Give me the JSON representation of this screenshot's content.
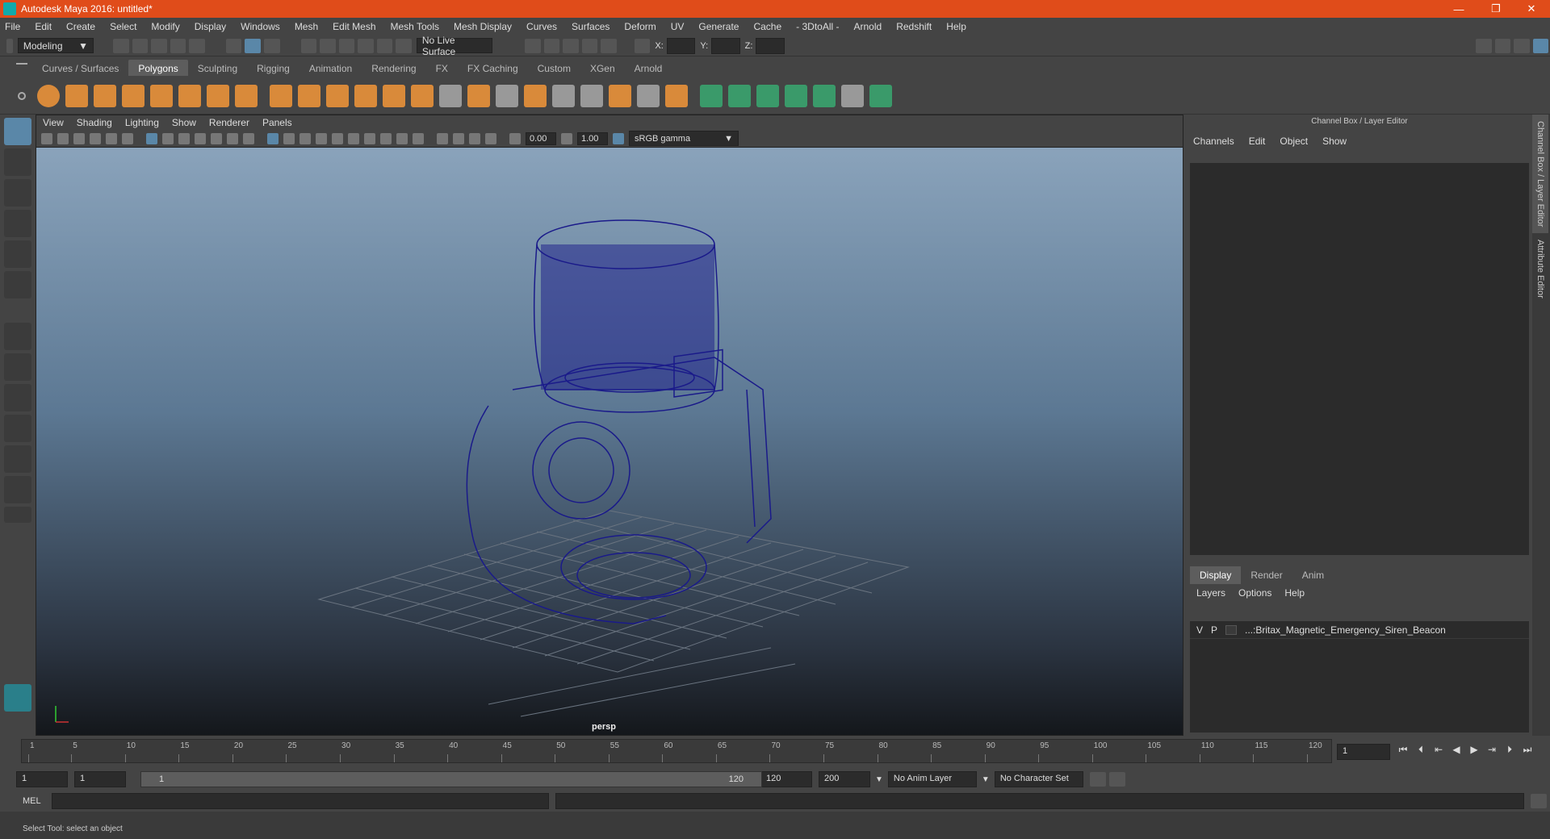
{
  "window": {
    "title": "Autodesk Maya 2016: untitled*",
    "minimize": "—",
    "restore": "❐",
    "close": "✕"
  },
  "menus": [
    "File",
    "Edit",
    "Create",
    "Select",
    "Modify",
    "Display",
    "Windows",
    "Mesh",
    "Edit Mesh",
    "Mesh Tools",
    "Mesh Display",
    "Curves",
    "Surfaces",
    "Deform",
    "UV",
    "Generate",
    "Cache",
    "- 3DtoAll -",
    "Arnold",
    "Redshift",
    "Help"
  ],
  "status": {
    "mode": "Modeling",
    "live_surface": "No Live Surface",
    "x_label": "X:",
    "y_label": "Y:",
    "z_label": "Z:"
  },
  "shelf": {
    "tabs": [
      "Curves / Surfaces",
      "Polygons",
      "Sculpting",
      "Rigging",
      "Animation",
      "Rendering",
      "FX",
      "FX Caching",
      "Custom",
      "XGen",
      "Arnold"
    ],
    "active": "Polygons"
  },
  "viewport": {
    "menus": [
      "View",
      "Shading",
      "Lighting",
      "Show",
      "Renderer",
      "Panels"
    ],
    "exposure": "0.00",
    "gamma": "1.00",
    "colorspace": "sRGB gamma",
    "camera": "persp"
  },
  "channelbox": {
    "title": "Channel Box / Layer Editor",
    "menus": [
      "Channels",
      "Edit",
      "Object",
      "Show"
    ]
  },
  "layer_editor": {
    "tabs": [
      "Display",
      "Render",
      "Anim"
    ],
    "active": "Display",
    "menus": [
      "Layers",
      "Options",
      "Help"
    ],
    "layers": [
      {
        "v": "V",
        "p": "P",
        "name": "...:Britax_Magnetic_Emergency_Siren_Beacon"
      }
    ]
  },
  "side_tabs": [
    "Channel Box / Layer Editor",
    "Attribute Editor"
  ],
  "timeline": {
    "ticks": [
      "1",
      "5",
      "10",
      "15",
      "20",
      "25",
      "30",
      "35",
      "40",
      "45",
      "50",
      "55",
      "60",
      "65",
      "70",
      "75",
      "80",
      "85",
      "90",
      "95",
      "100",
      "105",
      "110",
      "115",
      "120"
    ],
    "current_frame": "1"
  },
  "range": {
    "start": "1",
    "playback_start": "1",
    "slider_start": "1",
    "slider_end": "120",
    "playback_end": "120",
    "end": "200",
    "anim_layer": "No Anim Layer",
    "character_set": "No Character Set"
  },
  "command": {
    "label": "MEL"
  },
  "help": {
    "text": "Select Tool: select an object"
  }
}
